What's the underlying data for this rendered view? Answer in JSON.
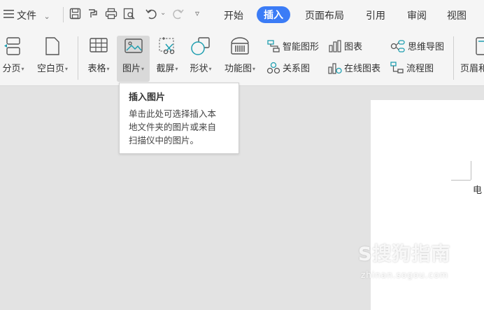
{
  "menubar": {
    "file_label": "文件",
    "tabs": [
      {
        "label": "开始",
        "active": false
      },
      {
        "label": "插入",
        "active": true
      },
      {
        "label": "页面布局",
        "active": false
      },
      {
        "label": "引用",
        "active": false
      },
      {
        "label": "审阅",
        "active": false
      },
      {
        "label": "视图",
        "active": false
      }
    ]
  },
  "ribbon": {
    "big_buttons": [
      {
        "label": "分页"
      },
      {
        "label": "空白页"
      },
      {
        "label": "表格"
      },
      {
        "label": "图片"
      },
      {
        "label": "截屏"
      },
      {
        "label": "形状"
      },
      {
        "label": "功能图"
      },
      {
        "label": "页眉和"
      }
    ],
    "small_buttons": [
      {
        "label": "智能图形"
      },
      {
        "label": "图表"
      },
      {
        "label": "思维导图"
      },
      {
        "label": "关系图"
      },
      {
        "label": "在线图表"
      },
      {
        "label": "流程图"
      }
    ]
  },
  "tooltip": {
    "title": "插入图片",
    "lines": [
      "单击此处可选择插入本",
      "地文件夹的图片或来自",
      "扫描仪中的图片。"
    ]
  },
  "document": {
    "text": "电"
  },
  "watermark": {
    "brand": "S搜狗指南",
    "url": "zhinan.sogou.com"
  },
  "colors": {
    "accent": "#3b7cf6",
    "background": "#e3e3e3",
    "toolbar": "#f5f5f5",
    "icon_teal": "#1f9fb0"
  }
}
